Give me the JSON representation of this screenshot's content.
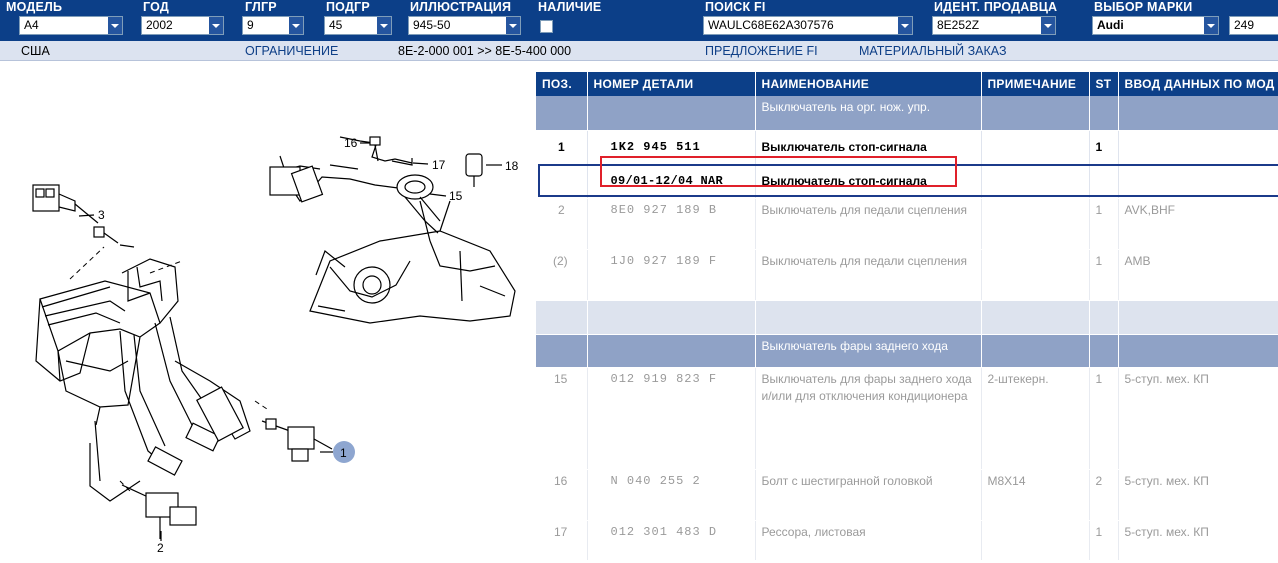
{
  "filters": {
    "model": {
      "label": "МОДЕЛЬ",
      "value": "A4"
    },
    "year": {
      "label": "ГОД",
      "value": "2002"
    },
    "main_group": {
      "label": "ГЛГР",
      "value": "9"
    },
    "sub_group": {
      "label": "ПОДГР",
      "value": "45"
    },
    "illustration": {
      "label": "ИЛЛЮСТРАЦИЯ",
      "value": "945-50"
    },
    "availability": {
      "label": "НАЛИЧИЕ"
    },
    "search_fi": {
      "label": "ПОИСК FI",
      "value": "WAULC68E62A307576"
    },
    "dealer_id": {
      "label": "ИДЕНТ. ПРОДАВЦА",
      "value": "8E252Z"
    },
    "brand": {
      "label": "ВЫБОР МАРКИ",
      "value": "Audi"
    },
    "brand_extra": "249"
  },
  "info": {
    "market": "США",
    "restriction_link": "ОГРАНИЧЕНИЕ",
    "restriction_value": "8E-2-000 001 >> 8E-5-400 000",
    "offer_link": "ПРЕДЛОЖЕНИЕ FI",
    "order_link": "МАТЕРИАЛЬНЫЙ ЗАКАЗ"
  },
  "illustration_callouts": [
    "16",
    "17",
    "18",
    "15",
    "3",
    "1",
    "2"
  ],
  "table": {
    "headers": [
      "ПОЗ.",
      "НОМЕР ДЕТАЛИ",
      "НАИМЕНОВАНИЕ",
      "ПРИМЕЧАНИЕ",
      "ST",
      "ВВОД ДАННЫХ ПО МОД"
    ],
    "rows": [
      {
        "type": "group",
        "pos": "",
        "number": "",
        "name": "Выключатель на орг. нож. упр.",
        "note": "",
        "st": "",
        "model": ""
      },
      {
        "type": "active",
        "pos": "1",
        "number": "1K2 945 511",
        "name": "Выключатель стоп-сигнала",
        "note": "",
        "st": "1",
        "model": ""
      },
      {
        "type": "active",
        "pos": "",
        "number": "09/01-12/04 NAR",
        "name": "Выключатель стоп-сигнала",
        "note": "",
        "st": "",
        "model": ""
      },
      {
        "type": "gray",
        "pos": "2",
        "number": "8E0 927 189 B",
        "name": "Выключатель для педали сцепления",
        "note": "",
        "st": "1",
        "model": "AVK,BHF"
      },
      {
        "type": "gray",
        "pos": "(2)",
        "number": "1J0 927 189 F",
        "name": "Выключатель для педали сцепления",
        "note": "",
        "st": "1",
        "model": "AMB"
      },
      {
        "type": "blank",
        "pos": "",
        "number": "",
        "name": "",
        "note": "",
        "st": "",
        "model": ""
      },
      {
        "type": "group",
        "pos": "",
        "number": "",
        "name": "Выключатель фары заднего хода",
        "note": "",
        "st": "",
        "model": ""
      },
      {
        "type": "gray",
        "pos": "15",
        "number": "012 919 823 F",
        "name": "Выключатель для фары заднего хода и/или для отключения кондиционера",
        "note": "2-штекерн.",
        "st": "1",
        "model": "5-ступ. мех. КП"
      },
      {
        "type": "gray",
        "pos": "16",
        "number": "N 040 255 2",
        "name": "Болт с шестигранной головкой",
        "note": "M8X14",
        "st": "2",
        "model": "5-ступ. мех. КП"
      },
      {
        "type": "gray",
        "pos": "17",
        "number": "012 301 483 D",
        "name": "Рессора, листовая",
        "note": "",
        "st": "1",
        "model": "5-ступ. мех. КП"
      }
    ]
  },
  "colors": {
    "header_bg": "#0c3f88",
    "group_row_bg": "#8fa2c6",
    "highlight_border": "#e0202a",
    "selected_row_border": "#1b3a8a"
  }
}
